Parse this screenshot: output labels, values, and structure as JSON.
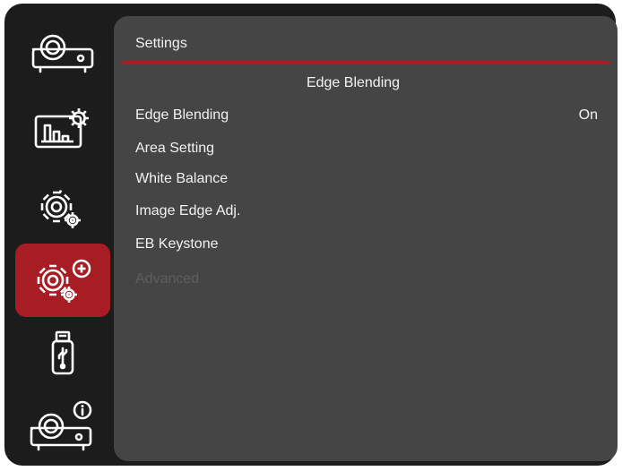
{
  "sidebar": {
    "items": [
      {
        "icon": "projector-icon",
        "active": false
      },
      {
        "icon": "picture-settings-icon",
        "active": false
      },
      {
        "icon": "settings-gear-icon",
        "active": false
      },
      {
        "icon": "advanced-settings-icon",
        "active": true
      },
      {
        "icon": "usb-icon",
        "active": false
      },
      {
        "icon": "projector-info-icon",
        "active": false
      }
    ]
  },
  "panel": {
    "title": "Settings",
    "subtitle": "Edge Blending",
    "items": [
      {
        "label": "Edge Blending",
        "value": "On",
        "enabled": true
      },
      {
        "label": "Area Setting",
        "value": "",
        "enabled": true
      },
      {
        "label": "White Balance",
        "value": "",
        "enabled": true
      },
      {
        "label": "Image Edge Adj.",
        "value": "",
        "enabled": true
      },
      {
        "label": "EB Keystone",
        "value": "",
        "enabled": true
      },
      {
        "label": "Advanced",
        "value": "",
        "enabled": false
      }
    ]
  },
  "colors": {
    "accent": "#a81c24",
    "panel_bg": "#454545",
    "frame_bg": "#1c1c1c",
    "text": "#f2f2f2",
    "disabled_text": "#5e5e5e"
  }
}
